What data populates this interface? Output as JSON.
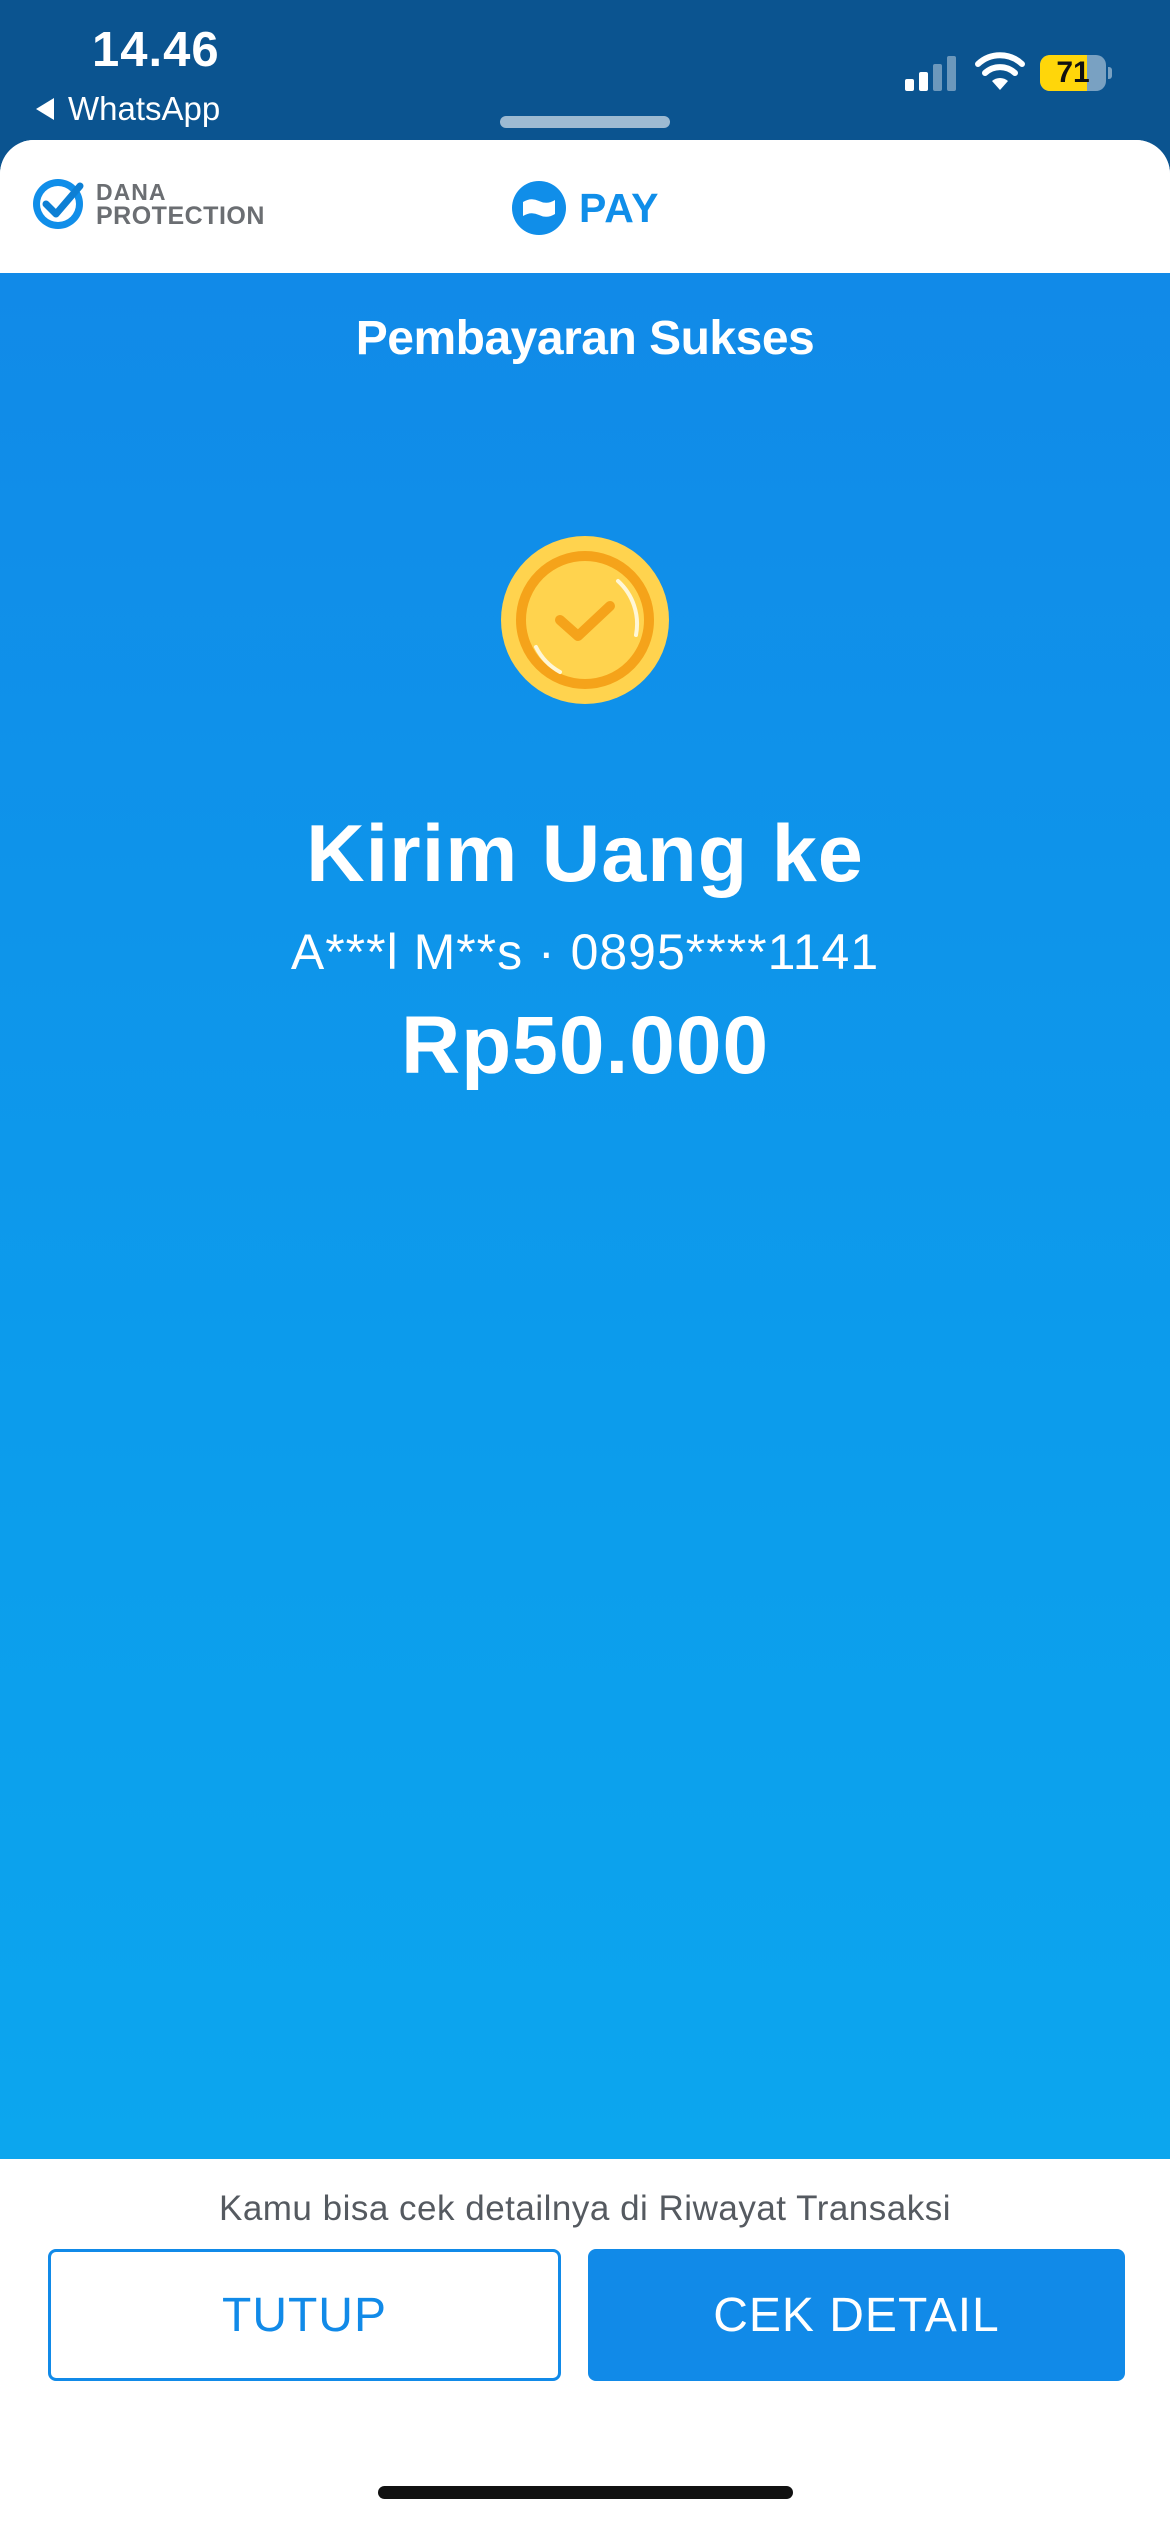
{
  "status_bar": {
    "time": "14.46",
    "back_app": "WhatsApp",
    "battery_level": "71",
    "battery_percent": 71
  },
  "header": {
    "protection_line1": "DANA",
    "protection_line2": "PROTECTION",
    "pay_label": "PAY"
  },
  "result": {
    "title": "Pembayaran Sukses",
    "headline": "Kirim Uang ke",
    "recipient": "A***l M**s · 0895****1141",
    "amount": "Rp50.000"
  },
  "footer": {
    "note": "Kamu bisa cek detailnya di Riwayat Transaksi",
    "close_label": "TUTUP",
    "detail_label": "CEK DETAIL"
  },
  "colors": {
    "brand_blue": "#118ae8",
    "status_bar_bg": "#0b5490",
    "coin_yellow": "#ffd34e",
    "coin_orange": "#f5a31a",
    "battery_yellow": "#ffd60a"
  }
}
